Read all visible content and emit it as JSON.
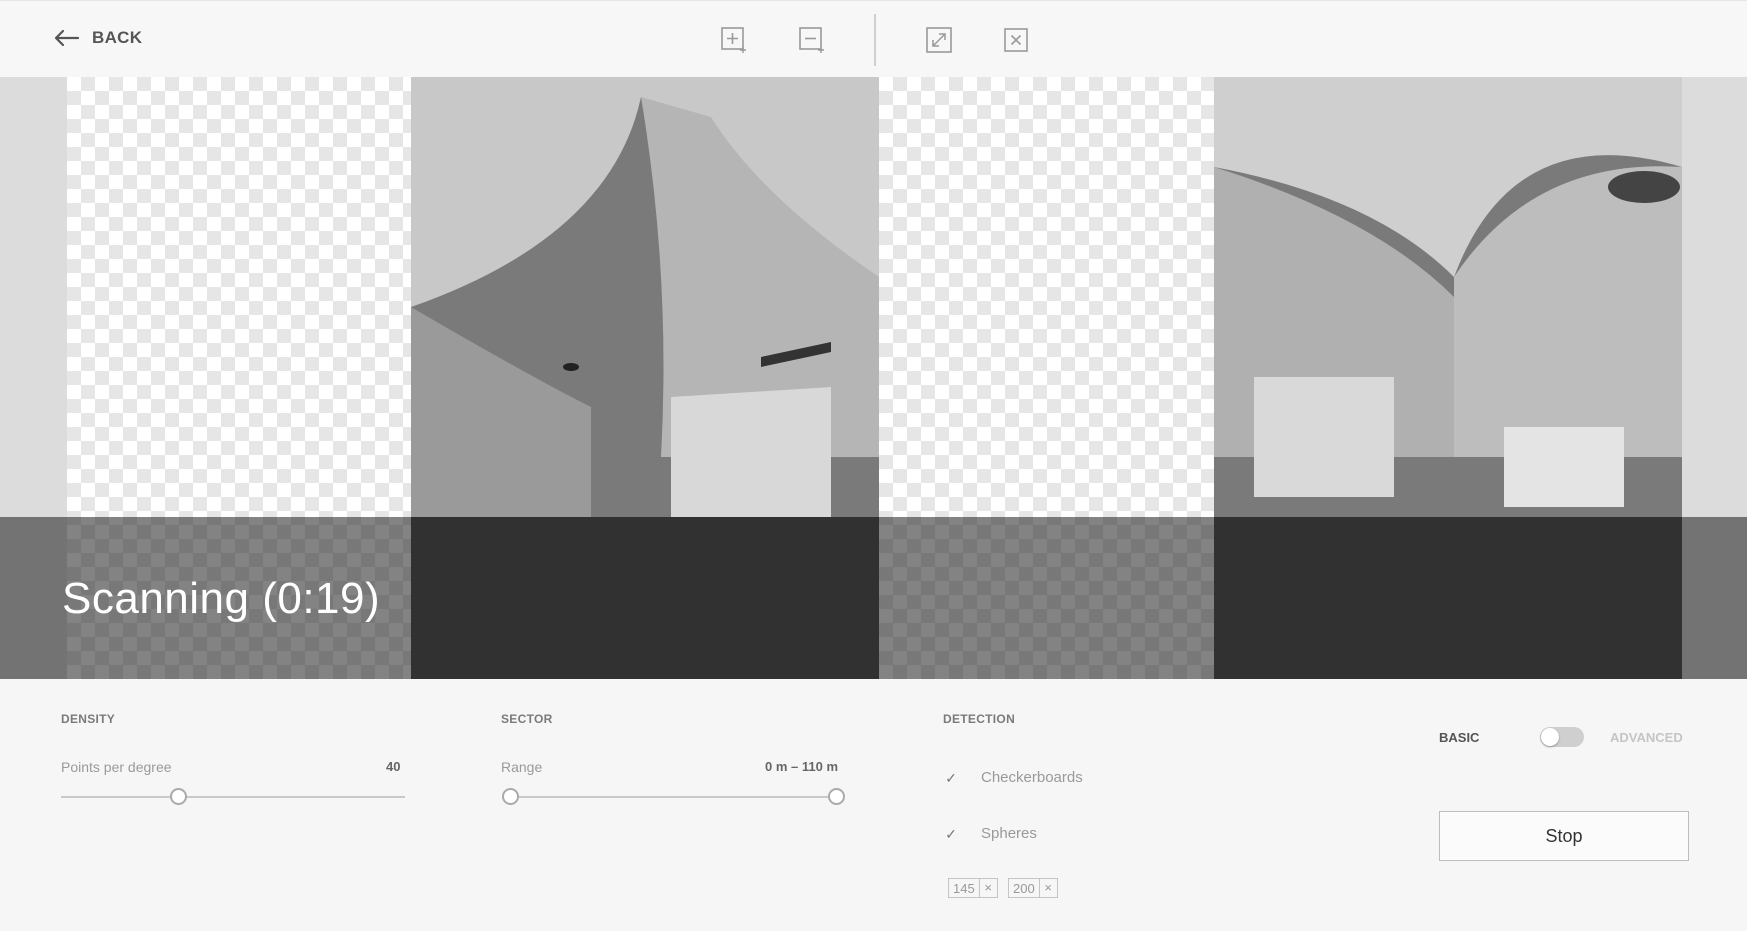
{
  "toolbar": {
    "back_label": "BACK",
    "icons": [
      "zoom-in-icon",
      "zoom-out-icon",
      "fullscreen-icon",
      "close-box-icon"
    ]
  },
  "viewer": {
    "status_text": "Scanning (0:19)"
  },
  "density": {
    "title": "DENSITY",
    "field_label": "Points per degree",
    "value": "40",
    "slider_fraction": 0.34
  },
  "sector": {
    "title": "SECTOR",
    "field_label": "Range",
    "value": "0 m – 110 m",
    "range_start_fraction": 0.0,
    "range_end_fraction": 1.0
  },
  "detection": {
    "title": "DETECTION",
    "options": [
      {
        "label": "Checkerboards",
        "checked": true
      },
      {
        "label": "Spheres",
        "checked": true
      }
    ],
    "sphere_sizes": [
      "145",
      "200"
    ]
  },
  "mode": {
    "basic_label": "BASIC",
    "advanced_label": "ADVANCED",
    "advanced_enabled": false
  },
  "actions": {
    "stop_label": "Stop"
  }
}
